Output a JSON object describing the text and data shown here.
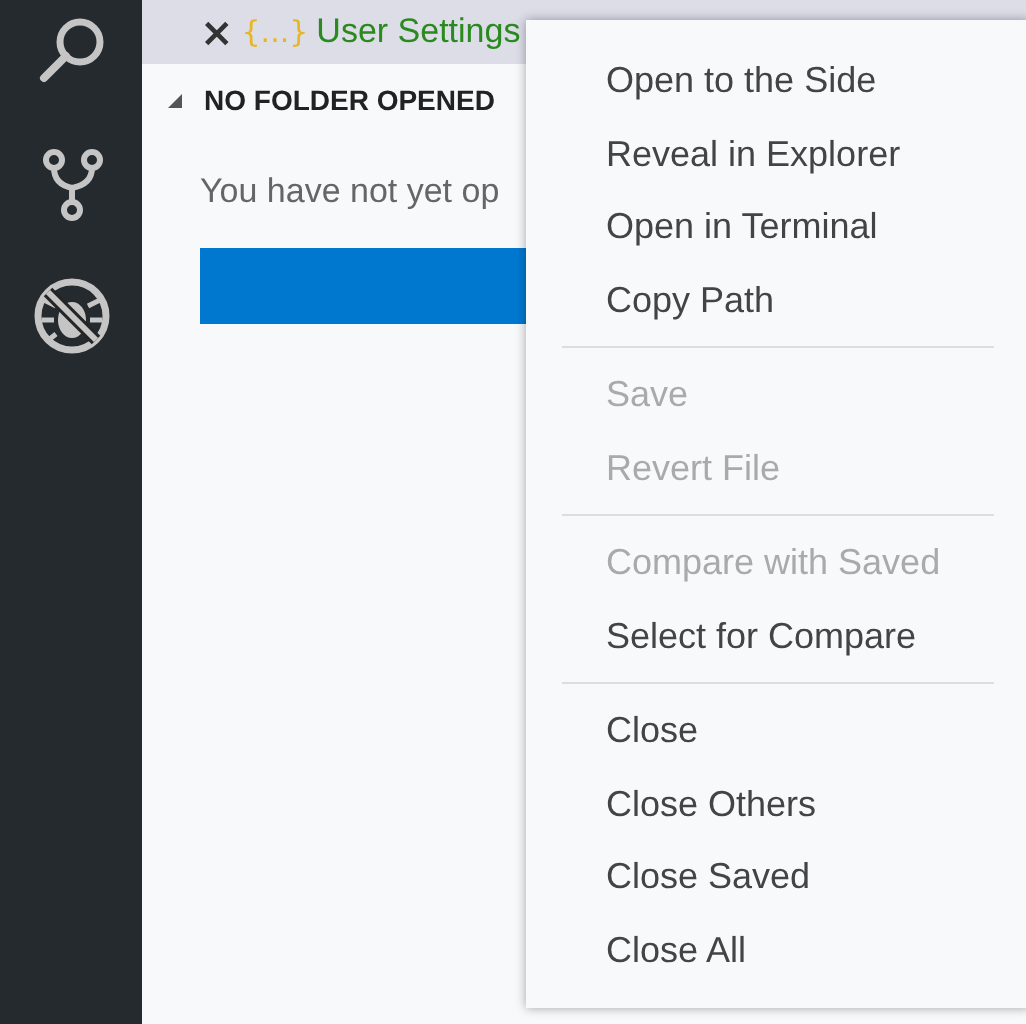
{
  "activity_bar": {
    "items": [
      {
        "kind": "search"
      },
      {
        "kind": "source-control"
      },
      {
        "kind": "debug"
      }
    ]
  },
  "tab": {
    "close": "×",
    "icon": "{...}",
    "title": "User Settings"
  },
  "explorer": {
    "section": "NO FOLDER OPENED",
    "expanded": true,
    "message": "You have not yet op"
  },
  "context_menu": [
    {
      "kind": "item",
      "label": "Open to the Side",
      "disabled": false
    },
    {
      "kind": "item",
      "label": "Reveal in Explorer",
      "disabled": false
    },
    {
      "kind": "item",
      "label": "Open in Terminal",
      "disabled": false
    },
    {
      "kind": "item",
      "label": "Copy Path",
      "disabled": false
    },
    {
      "kind": "separator"
    },
    {
      "kind": "item",
      "label": "Save",
      "disabled": true
    },
    {
      "kind": "item",
      "label": "Revert File",
      "disabled": true
    },
    {
      "kind": "separator"
    },
    {
      "kind": "item",
      "label": "Compare with Saved",
      "disabled": true
    },
    {
      "kind": "item",
      "label": "Select for Compare",
      "disabled": false
    },
    {
      "kind": "separator"
    },
    {
      "kind": "item",
      "label": "Close",
      "disabled": false
    },
    {
      "kind": "item",
      "label": "Close Others",
      "disabled": false
    },
    {
      "kind": "item",
      "label": "Close Saved",
      "disabled": false
    },
    {
      "kind": "item",
      "label": "Close All",
      "disabled": false
    }
  ]
}
